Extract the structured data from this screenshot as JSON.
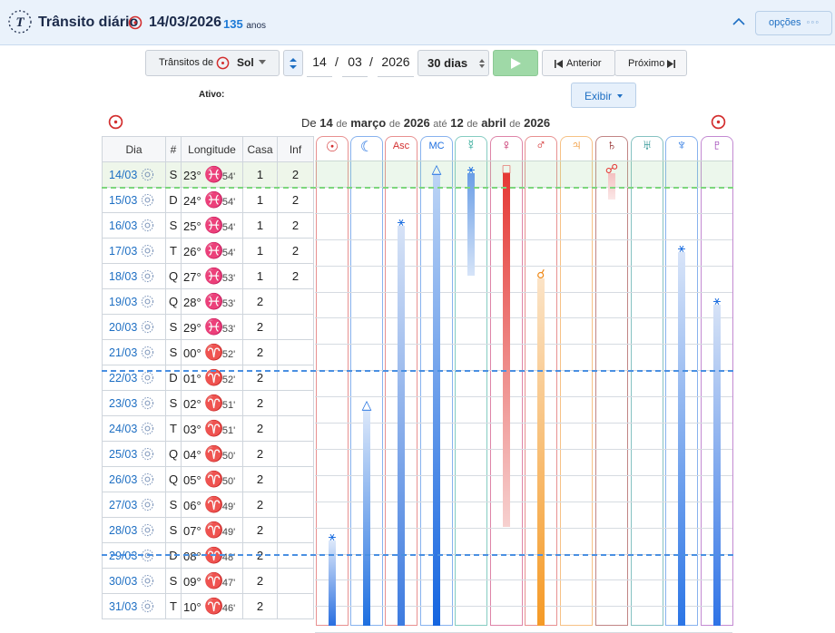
{
  "header": {
    "app_title": "Trânsito diário",
    "date": "14/03/2026",
    "age_value": "135",
    "age_unit": "anos",
    "options_label": "opções",
    "options_dots": "◦◦◦"
  },
  "toolbar": {
    "transits_of_label": "Trânsitos de",
    "transit_planet": "Sol",
    "day": "14",
    "month": "03",
    "year": "2026",
    "separator": "/",
    "period": "30 dias",
    "prev_label": "Anterior",
    "next_label": "Próximo",
    "active_label": "Ativo:",
    "show_label": "Exibir"
  },
  "range": {
    "de": "De",
    "start_day": "14",
    "de2": "de",
    "start_month": "março",
    "de3": "de",
    "start_year": "2026",
    "ate": "até",
    "end_day": "12",
    "de4": "de",
    "end_month": "abril",
    "de5": "de",
    "end_year": "2026"
  },
  "table": {
    "headers": [
      "Dia",
      "#",
      "Longitude",
      "Casa",
      "Inf"
    ],
    "rows": [
      {
        "date": "14/03",
        "wd": "S",
        "deg": "23°",
        "sign": "♓",
        "min": "54'",
        "casa": "1",
        "inf": "2"
      },
      {
        "date": "15/03",
        "wd": "D",
        "deg": "24°",
        "sign": "♓",
        "min": "54'",
        "casa": "1",
        "inf": "2"
      },
      {
        "date": "16/03",
        "wd": "S",
        "deg": "25°",
        "sign": "♓",
        "min": "54'",
        "casa": "1",
        "inf": "2"
      },
      {
        "date": "17/03",
        "wd": "T",
        "deg": "26°",
        "sign": "♓",
        "min": "54'",
        "casa": "1",
        "inf": "2"
      },
      {
        "date": "18/03",
        "wd": "Q",
        "deg": "27°",
        "sign": "♓",
        "min": "53'",
        "casa": "1",
        "inf": "2"
      },
      {
        "date": "19/03",
        "wd": "Q",
        "deg": "28°",
        "sign": "♓",
        "min": "53'",
        "casa": "2",
        "inf": ""
      },
      {
        "date": "20/03",
        "wd": "S",
        "deg": "29°",
        "sign": "♓",
        "min": "53'",
        "casa": "2",
        "inf": ""
      },
      {
        "date": "21/03",
        "wd": "S",
        "deg": "00°",
        "sign": "♈",
        "min": "52'",
        "casa": "2",
        "inf": ""
      },
      {
        "date": "22/03",
        "wd": "D",
        "deg": "01°",
        "sign": "♈",
        "min": "52'",
        "casa": "2",
        "inf": ""
      },
      {
        "date": "23/03",
        "wd": "S",
        "deg": "02°",
        "sign": "♈",
        "min": "51'",
        "casa": "2",
        "inf": ""
      },
      {
        "date": "24/03",
        "wd": "T",
        "deg": "03°",
        "sign": "♈",
        "min": "51'",
        "casa": "2",
        "inf": ""
      },
      {
        "date": "25/03",
        "wd": "Q",
        "deg": "04°",
        "sign": "♈",
        "min": "50'",
        "casa": "2",
        "inf": ""
      },
      {
        "date": "26/03",
        "wd": "Q",
        "deg": "05°",
        "sign": "♈",
        "min": "50'",
        "casa": "2",
        "inf": ""
      },
      {
        "date": "27/03",
        "wd": "S",
        "deg": "06°",
        "sign": "♈",
        "min": "49'",
        "casa": "2",
        "inf": ""
      },
      {
        "date": "28/03",
        "wd": "S",
        "deg": "07°",
        "sign": "♈",
        "min": "49'",
        "casa": "2",
        "inf": ""
      },
      {
        "date": "29/03",
        "wd": "D",
        "deg": "08°",
        "sign": "♈",
        "min": "48'",
        "casa": "2",
        "inf": ""
      },
      {
        "date": "30/03",
        "wd": "S",
        "deg": "09°",
        "sign": "♈",
        "min": "47'",
        "casa": "2",
        "inf": ""
      },
      {
        "date": "31/03",
        "wd": "T",
        "deg": "10°",
        "sign": "♈",
        "min": "46'",
        "casa": "2",
        "inf": ""
      }
    ]
  },
  "planets": [
    {
      "glyph": "☉",
      "name": "sun",
      "color": "#d32f2f"
    },
    {
      "glyph": "☾",
      "name": "moon",
      "color": "#1e6fe0"
    },
    {
      "glyph": "Asc",
      "name": "asc",
      "color": "#d32f2f"
    },
    {
      "glyph": "MC",
      "name": "mc",
      "color": "#1e6fe0"
    },
    {
      "glyph": "☿",
      "name": "mercury",
      "color": "#1aa08c"
    },
    {
      "glyph": "♀",
      "name": "venus",
      "color": "#c2185b"
    },
    {
      "glyph": "♂",
      "name": "mars",
      "color": "#d32f2f"
    },
    {
      "glyph": "♃",
      "name": "jupiter",
      "color": "#ef8a1a"
    },
    {
      "glyph": "♄",
      "name": "saturn",
      "color": "#8b1a1a"
    },
    {
      "glyph": "♅",
      "name": "uranus",
      "color": "#1a8a8a"
    },
    {
      "glyph": "♆",
      "name": "neptune",
      "color": "#1e6fe0"
    },
    {
      "glyph": "♇",
      "name": "pluto",
      "color": "#8e24aa"
    }
  ],
  "aspects": [
    {
      "planet": "mc",
      "glyph": "△",
      "color": "#1e6fe0"
    },
    {
      "planet": "mercury",
      "glyph": "⚹",
      "color": "#1e6fe0"
    },
    {
      "planet": "venus",
      "glyph": "□",
      "color": "#e53935"
    },
    {
      "planet": "saturn",
      "glyph": "☍",
      "color": "#e53935"
    },
    {
      "planet": "asc",
      "glyph": "⚹",
      "color": "#1e6fe0"
    },
    {
      "planet": "neptune",
      "glyph": "⚹",
      "color": "#1e6fe0"
    },
    {
      "planet": "mars",
      "glyph": "☌",
      "color": "#ef8a1a"
    },
    {
      "planet": "pluto",
      "glyph": "⚹",
      "color": "#1e6fe0"
    },
    {
      "planet": "moon",
      "glyph": "△",
      "color": "#1e6fe0"
    },
    {
      "planet": "sun",
      "glyph": "⚹",
      "color": "#1e6fe0"
    }
  ],
  "colors": {
    "accent": "#1e6fc3",
    "play_green": "#9fd9a7",
    "header_bg": "#eaf2fb"
  }
}
